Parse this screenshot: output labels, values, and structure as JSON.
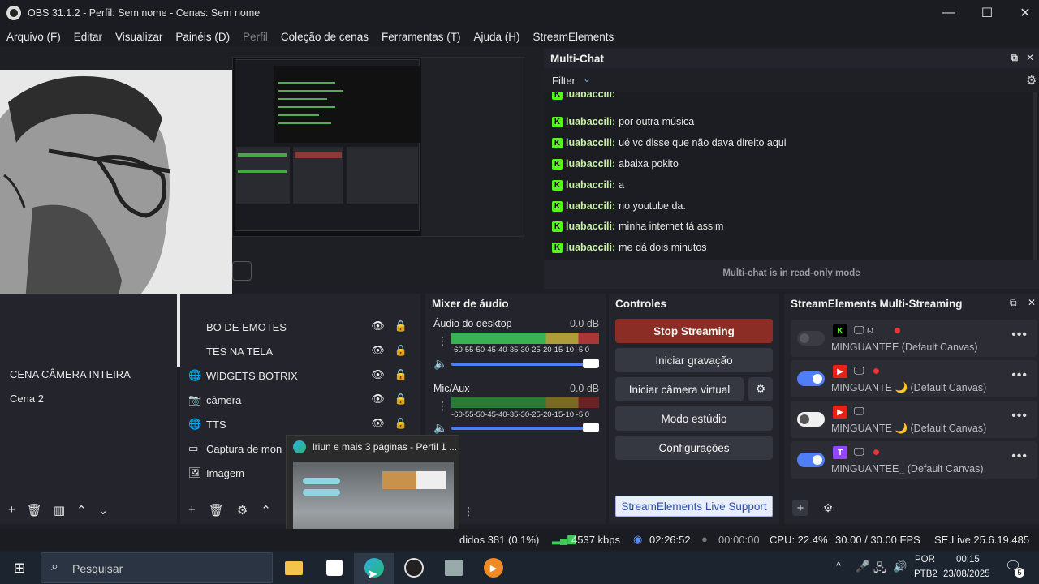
{
  "window": {
    "title": "OBS 31.1.2 - Perfil: Sem nome - Cenas: Sem nome",
    "min_icon": "minimize-icon",
    "max_icon": "maximize-icon",
    "close_icon": "close-icon"
  },
  "menu": [
    "Arquivo (F)",
    "Editar",
    "Visualizar",
    "Painéis (D)",
    "Perfil",
    "Coleção de cenas",
    "Ferramentas (T)",
    "Ajuda (H)",
    "StreamElements"
  ],
  "multichat": {
    "title": "Multi-Chat",
    "filter_label": "Filter",
    "footer": "Multi-chat is in read-only mode",
    "messages": [
      {
        "user": "luabaccili:",
        "text": "por outra música"
      },
      {
        "user": "luabaccili:",
        "text": "ué vc disse que não dava direito aqui"
      },
      {
        "user": "luabaccili:",
        "text": "abaixa pokito"
      },
      {
        "user": "luabaccili:",
        "text": "a"
      },
      {
        "user": "luabaccili:",
        "text": "no youtube da."
      },
      {
        "user": "luabaccili:",
        "text": "minha internet tá assim"
      },
      {
        "user": "luabaccili:",
        "text": "me dá dois minutos"
      }
    ]
  },
  "scenes": {
    "items": [
      "CENA CÂMERA INTEIRA",
      "Cena 2"
    ]
  },
  "sources": {
    "items": [
      {
        "label": "BO DE EMOTES",
        "icon": ""
      },
      {
        "label": "TES NA TELA",
        "icon": ""
      },
      {
        "label": "WIDGETS BOTRIX",
        "icon": "globe-icon"
      },
      {
        "label": "câmera",
        "icon": "camera-icon"
      },
      {
        "label": "TTS",
        "icon": "globe-icon"
      },
      {
        "label": "Captura de mon",
        "icon": "monitor-icon"
      },
      {
        "label": "Imagem",
        "icon": "image-icon"
      }
    ]
  },
  "mixer": {
    "title": "Mixer de áudio",
    "channels": [
      {
        "name": "Áudio do desktop",
        "db": "0.0 dB",
        "volume": 0.95
      },
      {
        "name": "Mic/Aux",
        "db": "0.0 dB",
        "volume": 0.95
      }
    ],
    "scale": "-60-55-50-45-40-35-30-25-20-15-10 -5  0"
  },
  "controls": {
    "title": "Controles",
    "stop_streaming": "Stop Streaming",
    "start_recording": "Iniciar gravação",
    "virtual_cam": "Iniciar câmera virtual",
    "studio_mode": "Modo estúdio",
    "settings": "Configurações",
    "live_support": "StreamElements Live Support"
  },
  "multistream": {
    "title": "StreamElements Multi-Streaming",
    "rows": [
      {
        "platform": "K",
        "name": "MINGUANTEE (Default Canvas)",
        "state": "disabled",
        "color": "#00c800"
      },
      {
        "platform": "▶",
        "name": "MINGUANTE 🌙 (Default Canvas)",
        "state": "on",
        "color": "#e62117"
      },
      {
        "platform": "▶",
        "name": "MINGUANTE 🌙 (Default Canvas)",
        "state": "off",
        "color": "#e62117"
      },
      {
        "platform": "T",
        "name": "MINGUANTEE_ (Default Canvas)",
        "state": "on",
        "color": "#9146ff"
      }
    ]
  },
  "thumbnail": {
    "title": "lriun e mais 3 páginas - Perfil 1 ..."
  },
  "status": {
    "dropped": "didos 381 (0.1%)",
    "bitrate": "4537 kbps",
    "stream_time": "02:26:52",
    "rec_time": "00:00:00",
    "cpu": "CPU: 22.4%",
    "fps": "30.00 / 30.00 FPS",
    "version": "SE.Live 25.6.19.485"
  },
  "taskbar": {
    "search": "Pesquisar",
    "lang_top": "POR",
    "lang_bottom": "PTB2",
    "time": "00:15",
    "date": "23/08/2025",
    "notif_count": "5"
  }
}
